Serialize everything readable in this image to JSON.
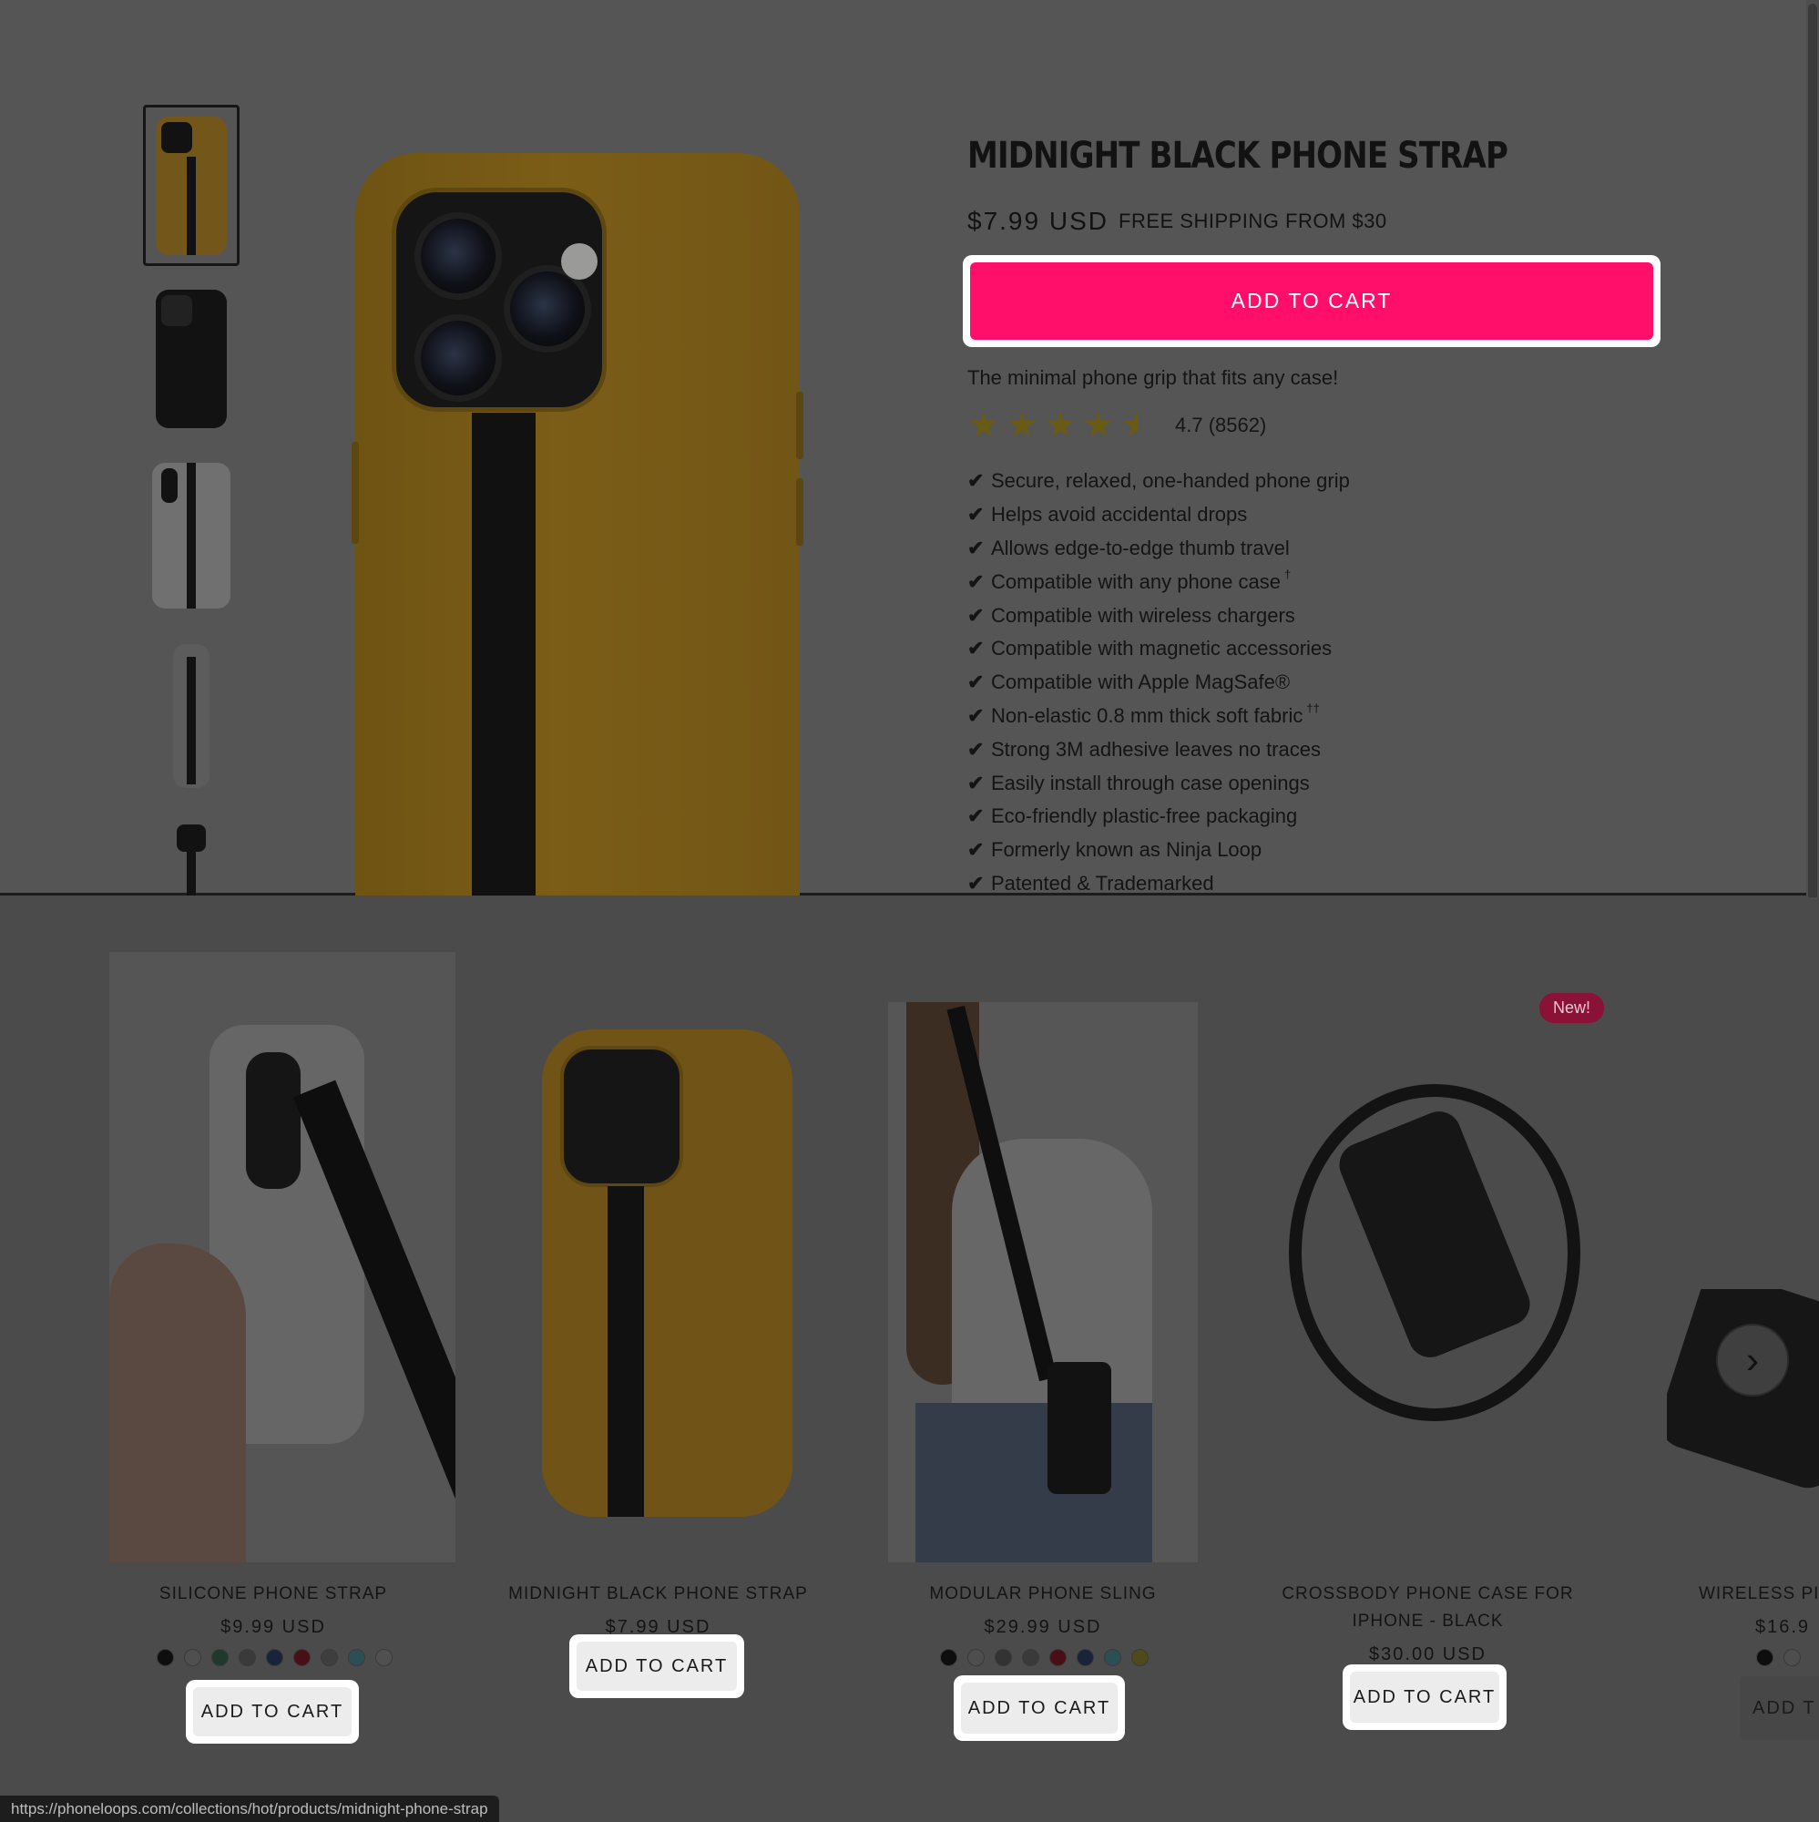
{
  "product": {
    "title": "MIDNIGHT BLACK PHONE STRAP",
    "price": "$7.99 USD",
    "shipping": "FREE SHIPPING FROM $30",
    "add_to_cart": "ADD TO CART",
    "tagline": "The minimal phone grip that fits any case!",
    "rating": 4.7,
    "rating_text": "4.7 (8562)",
    "features": [
      {
        "text": "Secure, relaxed, one-handed phone grip",
        "mark": ""
      },
      {
        "text": "Helps avoid accidental drops",
        "mark": ""
      },
      {
        "text": "Allows edge-to-edge thumb travel",
        "mark": ""
      },
      {
        "text": "Compatible with any phone case",
        "mark": "†"
      },
      {
        "text": "Compatible with wireless chargers",
        "mark": ""
      },
      {
        "text": "Compatible with magnetic accessories",
        "mark": ""
      },
      {
        "text": "Compatible with Apple MagSafe®",
        "mark": ""
      },
      {
        "text": "Non-elastic 0.8 mm thick soft fabric",
        "mark": "††"
      },
      {
        "text": "Strong 3M adhesive leaves no traces",
        "mark": ""
      },
      {
        "text": "Easily install through case openings",
        "mark": ""
      },
      {
        "text": "Eco-friendly plastic-free packaging",
        "mark": ""
      },
      {
        "text": "Formerly known as Ninja Loop",
        "mark": ""
      },
      {
        "text": "Patented & Trademarked",
        "mark": ""
      }
    ],
    "check_icon": "✔",
    "star_icon": "★",
    "accent": "#ff0f6a"
  },
  "recommendations": [
    {
      "name": "SILICONE PHONE STRAP",
      "price": "$9.99 USD",
      "button": "ADD TO CART",
      "swatches": [
        "#0e0e0e",
        "#4f4f4f",
        "#1f3a2c",
        "#3a3a3a",
        "#19233a",
        "#4a0f16",
        "#3e3e3e",
        "#2c4f55",
        "#505050"
      ]
    },
    {
      "name": "MIDNIGHT BLACK PHONE STRAP",
      "price": "$7.99 USD",
      "button": "ADD TO CART",
      "swatches": []
    },
    {
      "name": "MODULAR PHONE SLING",
      "price": "$29.99 USD",
      "button": "ADD TO CART",
      "swatches": [
        "#0e0e0e",
        "#4e4e4e",
        "#333333",
        "#3a3a3a",
        "#4a0f16",
        "#19233a",
        "#2c4f55",
        "#4e4a1c"
      ]
    },
    {
      "name": "CROSSBODY PHONE CASE FOR IPHONE - BLACK",
      "price": "$30.00 USD",
      "button": "ADD TO CART",
      "swatches": []
    },
    {
      "name": "WIRELESS PI",
      "price": "$16.9",
      "button": "ADD T",
      "swatches": [
        "#0e0e0e",
        "#4e4e4e"
      ]
    }
  ],
  "badge_new": "New!",
  "next_icon": "›",
  "status_url": "https://phoneloops.com/collections/hot/products/midnight-phone-strap"
}
